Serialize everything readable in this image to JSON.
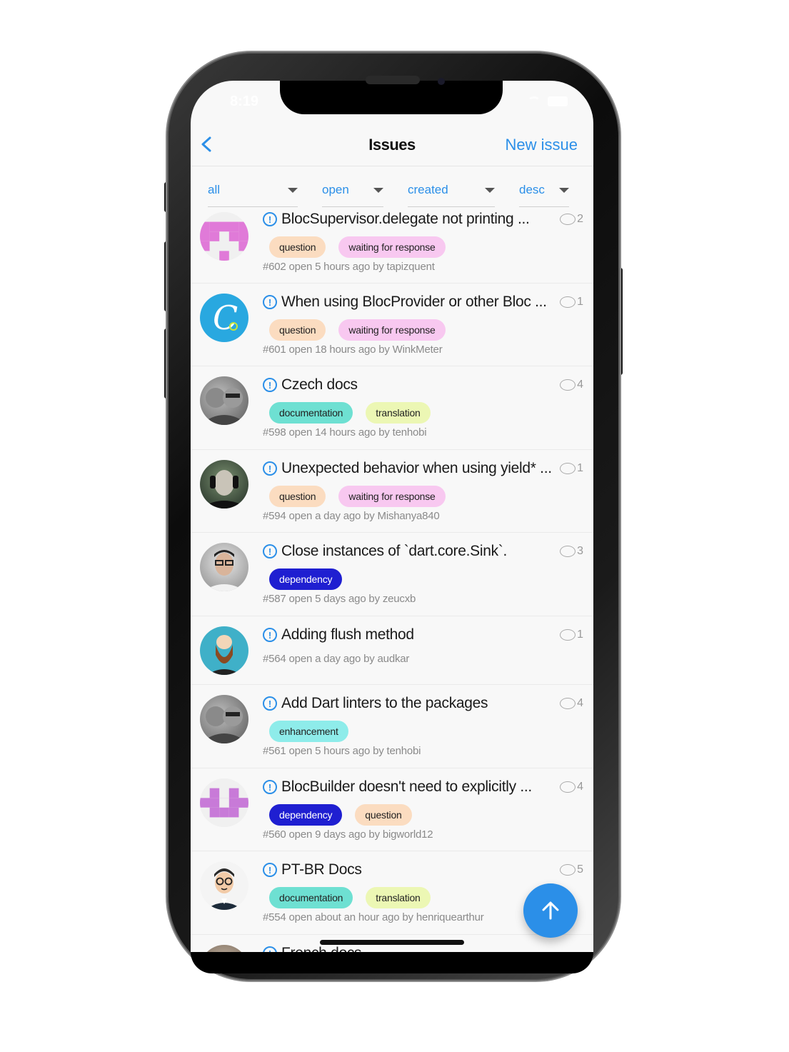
{
  "status": {
    "time": "8:19"
  },
  "nav": {
    "title": "Issues",
    "new_issue": "New issue"
  },
  "filters": [
    {
      "label": "all"
    },
    {
      "label": "open"
    },
    {
      "label": "created"
    },
    {
      "label": "desc"
    }
  ],
  "colors": {
    "accent": "#2b8fe8",
    "question": "#fbdcc0",
    "waiting": "#f8c8f0",
    "documentation": "#6ee0d2",
    "translation": "#ecf7b4",
    "dependency": "#1f1fd1",
    "enhancement": "#8eecea"
  },
  "issues": [
    {
      "title": "BlocSupervisor.delegate not printing ...",
      "comments": "2",
      "labels": [
        "question",
        "waiting for response"
      ],
      "meta": "#602 open 5 hours ago by tapizquent",
      "avatar": "identicon-pink"
    },
    {
      "title": "When using BlocProvider or other Bloc ...",
      "comments": "1",
      "labels": [
        "question",
        "waiting for response"
      ],
      "meta": "#601 open 18 hours ago by WinkMeter",
      "avatar": "logo-c"
    },
    {
      "title": "Czech docs",
      "comments": "4",
      "labels": [
        "documentation",
        "translation"
      ],
      "meta": "#598 open 14 hours ago by tenhobi",
      "avatar": "photo-couple"
    },
    {
      "title": "Unexpected behavior when using yield* ...",
      "comments": "1",
      "labels": [
        "question",
        "waiting for response"
      ],
      "meta": "#594 open a day ago by Mishanya840",
      "avatar": "photo-headphones"
    },
    {
      "title": "Close instances of `dart.core.Sink`.",
      "comments": "3",
      "labels": [
        "dependency"
      ],
      "meta": "#587 open 5 days ago by zeucxb",
      "avatar": "photo-glasses"
    },
    {
      "title": "Adding flush method",
      "comments": "1",
      "labels": [],
      "meta": "#564 open a day ago by audkar",
      "avatar": "cartoon-beard"
    },
    {
      "title": "Add Dart linters to the packages",
      "comments": "4",
      "labels": [
        "enhancement"
      ],
      "meta": "#561 open 5 hours ago by tenhobi",
      "avatar": "photo-couple"
    },
    {
      "title": "BlocBuilder doesn't need to explicitly ...",
      "comments": "4",
      "labels": [
        "dependency",
        "question"
      ],
      "meta": "#560 open 9 days ago by bigworld12",
      "avatar": "identicon-purple"
    },
    {
      "title": "PT-BR Docs",
      "comments": "5",
      "labels": [
        "documentation",
        "translation"
      ],
      "meta": "#554 open about an hour ago by henriquearthur",
      "avatar": "cartoon-glasses"
    },
    {
      "title": "French docs",
      "comments": "",
      "labels": [],
      "meta": "",
      "avatar": "photo-partial"
    }
  ]
}
